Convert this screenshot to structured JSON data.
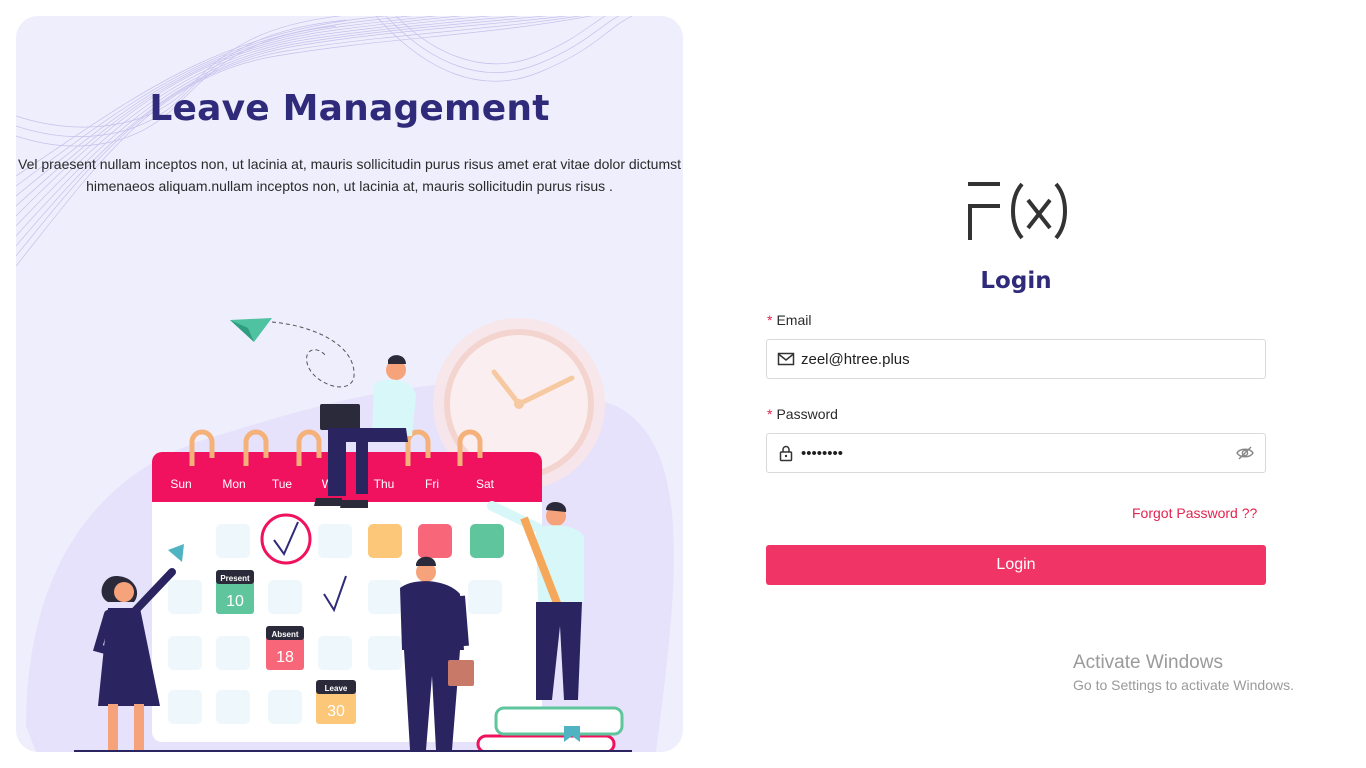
{
  "hero": {
    "title": "Leave Management",
    "description_line1": "Vel praesent nullam inceptos non, ut lacinia at, mauris sollicitudin purus risus amet erat vitae dolor dictumst",
    "description_line2": "himenaeos aliquam.nullam inceptos non, ut lacinia at, mauris sollicitudin purus risus ."
  },
  "calendar": {
    "days": [
      "Sun",
      "Mon",
      "Tue",
      "Wed",
      "Thu",
      "Fri",
      "Sat"
    ],
    "badges": {
      "present": {
        "label": "Present",
        "number": "10"
      },
      "absent": {
        "label": "Absent",
        "number": "18"
      },
      "leave": {
        "label": "Leave",
        "number": "30"
      }
    }
  },
  "brand": {
    "logo_icon": "fx-logo-icon"
  },
  "login": {
    "title": "Login",
    "email_label": "Email",
    "email_value": "zeel@htree.plus",
    "password_label": "Password",
    "password_value": "12345678",
    "required_mark": "*",
    "forgot_label": "Forgot Password ??",
    "button_label": "Login"
  },
  "watermark": {
    "line1": "Activate Windows",
    "line2": "Go to Settings to activate Windows."
  },
  "colors": {
    "accent": "#f03466",
    "title": "#2f2a7a",
    "panel_bg": "#efeefc"
  }
}
